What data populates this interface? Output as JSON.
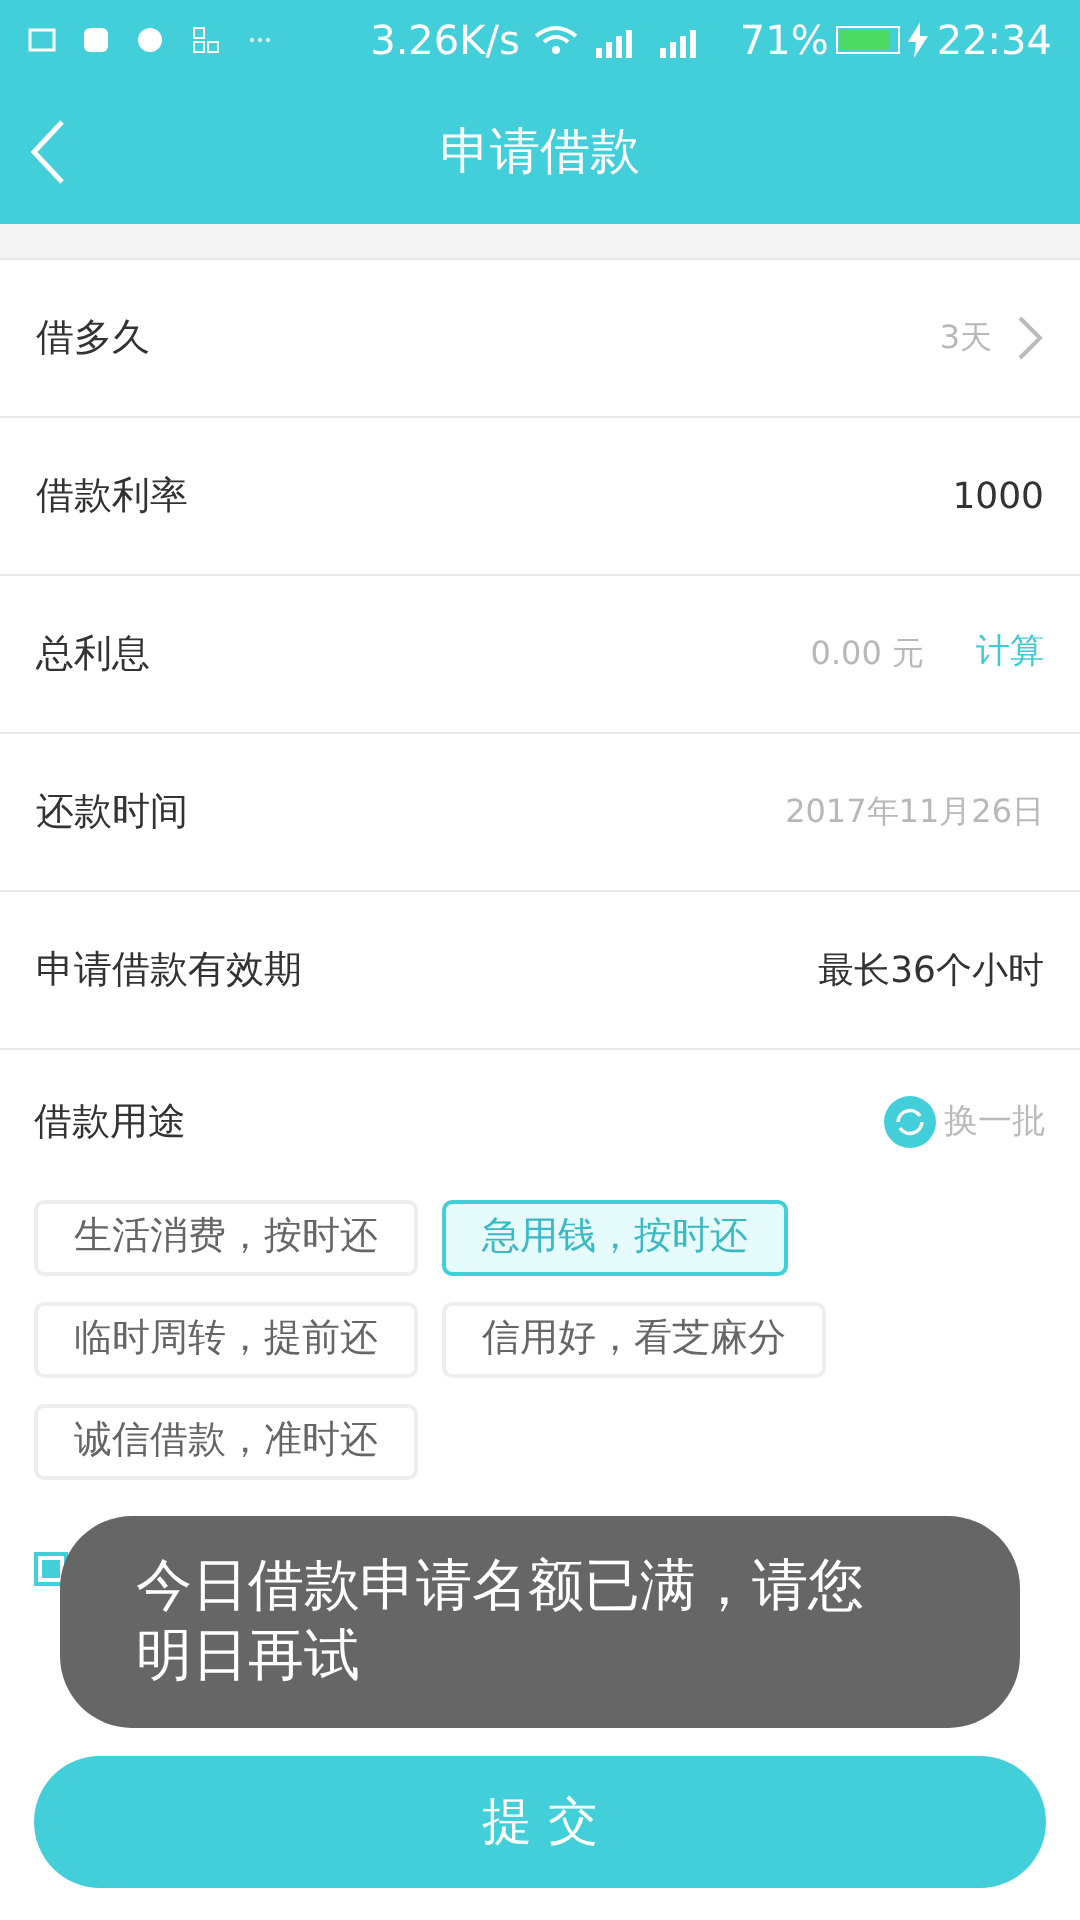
{
  "status_bar": {
    "speed": "3.26K/s",
    "battery": "71%",
    "time": "22:34"
  },
  "header": {
    "title": "申请借款"
  },
  "rows": [
    {
      "kind": "link",
      "label": "借多久",
      "value": "3天"
    },
    {
      "kind": "value",
      "label": "借款利率",
      "value": "1000"
    },
    {
      "kind": "action",
      "label": "总利息",
      "value": "0.00 元",
      "action": "计算"
    },
    {
      "kind": "muted",
      "label": "还款时间",
      "value": "2017年11月26日"
    },
    {
      "kind": "value",
      "label": "申请借款有效期",
      "value": "最长36个小时"
    }
  ],
  "purpose": {
    "label": "借款用途",
    "refresh": "换一批",
    "tags": [
      {
        "text": "生活消费，按时还",
        "selected": false
      },
      {
        "text": "急用钱，按时还",
        "selected": true
      },
      {
        "text": "临时周转，提前还",
        "selected": false
      },
      {
        "text": "信用好，看芝麻分",
        "selected": false
      },
      {
        "text": "诚信借款，准时还",
        "selected": false
      }
    ]
  },
  "agreement": {
    "checked": true
  },
  "toast": {
    "message": "今日借款申请名额已满，请您明日再试"
  },
  "submit": {
    "label": "提 交"
  }
}
